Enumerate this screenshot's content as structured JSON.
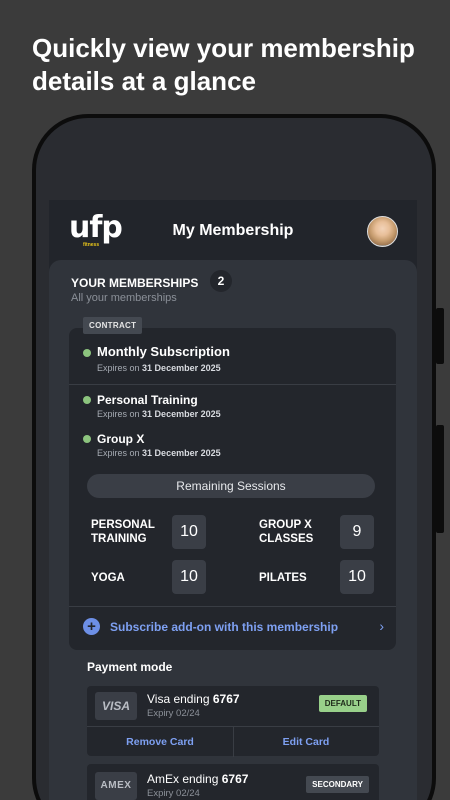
{
  "promo": {
    "headline": "Quickly view your membership details at a glance"
  },
  "header": {
    "logo": "ufp",
    "logo_sub": "fitness",
    "title": "My Membership"
  },
  "memberships": {
    "title": "YOUR MEMBERSHIPS",
    "count": "2",
    "subtitle": "All your memberships",
    "contract_tag": "CONTRACT",
    "plans": [
      {
        "name": "Monthly Subscription",
        "expires_prefix": "Expires on",
        "expires_date": "31 December 2025"
      },
      {
        "name": "Personal Training",
        "expires_prefix": "Expires on",
        "expires_date": "31 December 2025"
      },
      {
        "name": "Group X",
        "expires_prefix": "Expires on",
        "expires_date": "31 December 2025"
      }
    ],
    "remaining_label": "Remaining Sessions",
    "sessions": [
      {
        "label_line1": "PERSONAL",
        "label_line2": "TRAINING",
        "value": "10"
      },
      {
        "label_line1": "GROUP X",
        "label_line2": "CLASSES",
        "value": "9"
      },
      {
        "label_line1": "YOGA",
        "label_line2": "",
        "value": "10"
      },
      {
        "label_line1": "PILATES",
        "label_line2": "",
        "value": "10"
      }
    ],
    "subscribe_text": "Subscribe add-on with this membership"
  },
  "payment": {
    "title": "Payment mode",
    "cards": [
      {
        "brand": "VISA",
        "name_prefix": "Visa ending",
        "last4": "6767",
        "expiry": "Expiry 02/24",
        "badge": "DEFAULT",
        "remove_label": "Remove Card",
        "edit_label": "Edit Card"
      },
      {
        "brand": "AMEX",
        "name_prefix": "AmEx ending",
        "last4": "6767",
        "expiry": "Expiry 02/24",
        "badge": "SECONDARY"
      }
    ]
  },
  "colors": {
    "background": "#3b3b3b",
    "accent_blue": "#7ea0f2",
    "status_green": "#8cc47e",
    "default_badge": "#98d08a"
  }
}
